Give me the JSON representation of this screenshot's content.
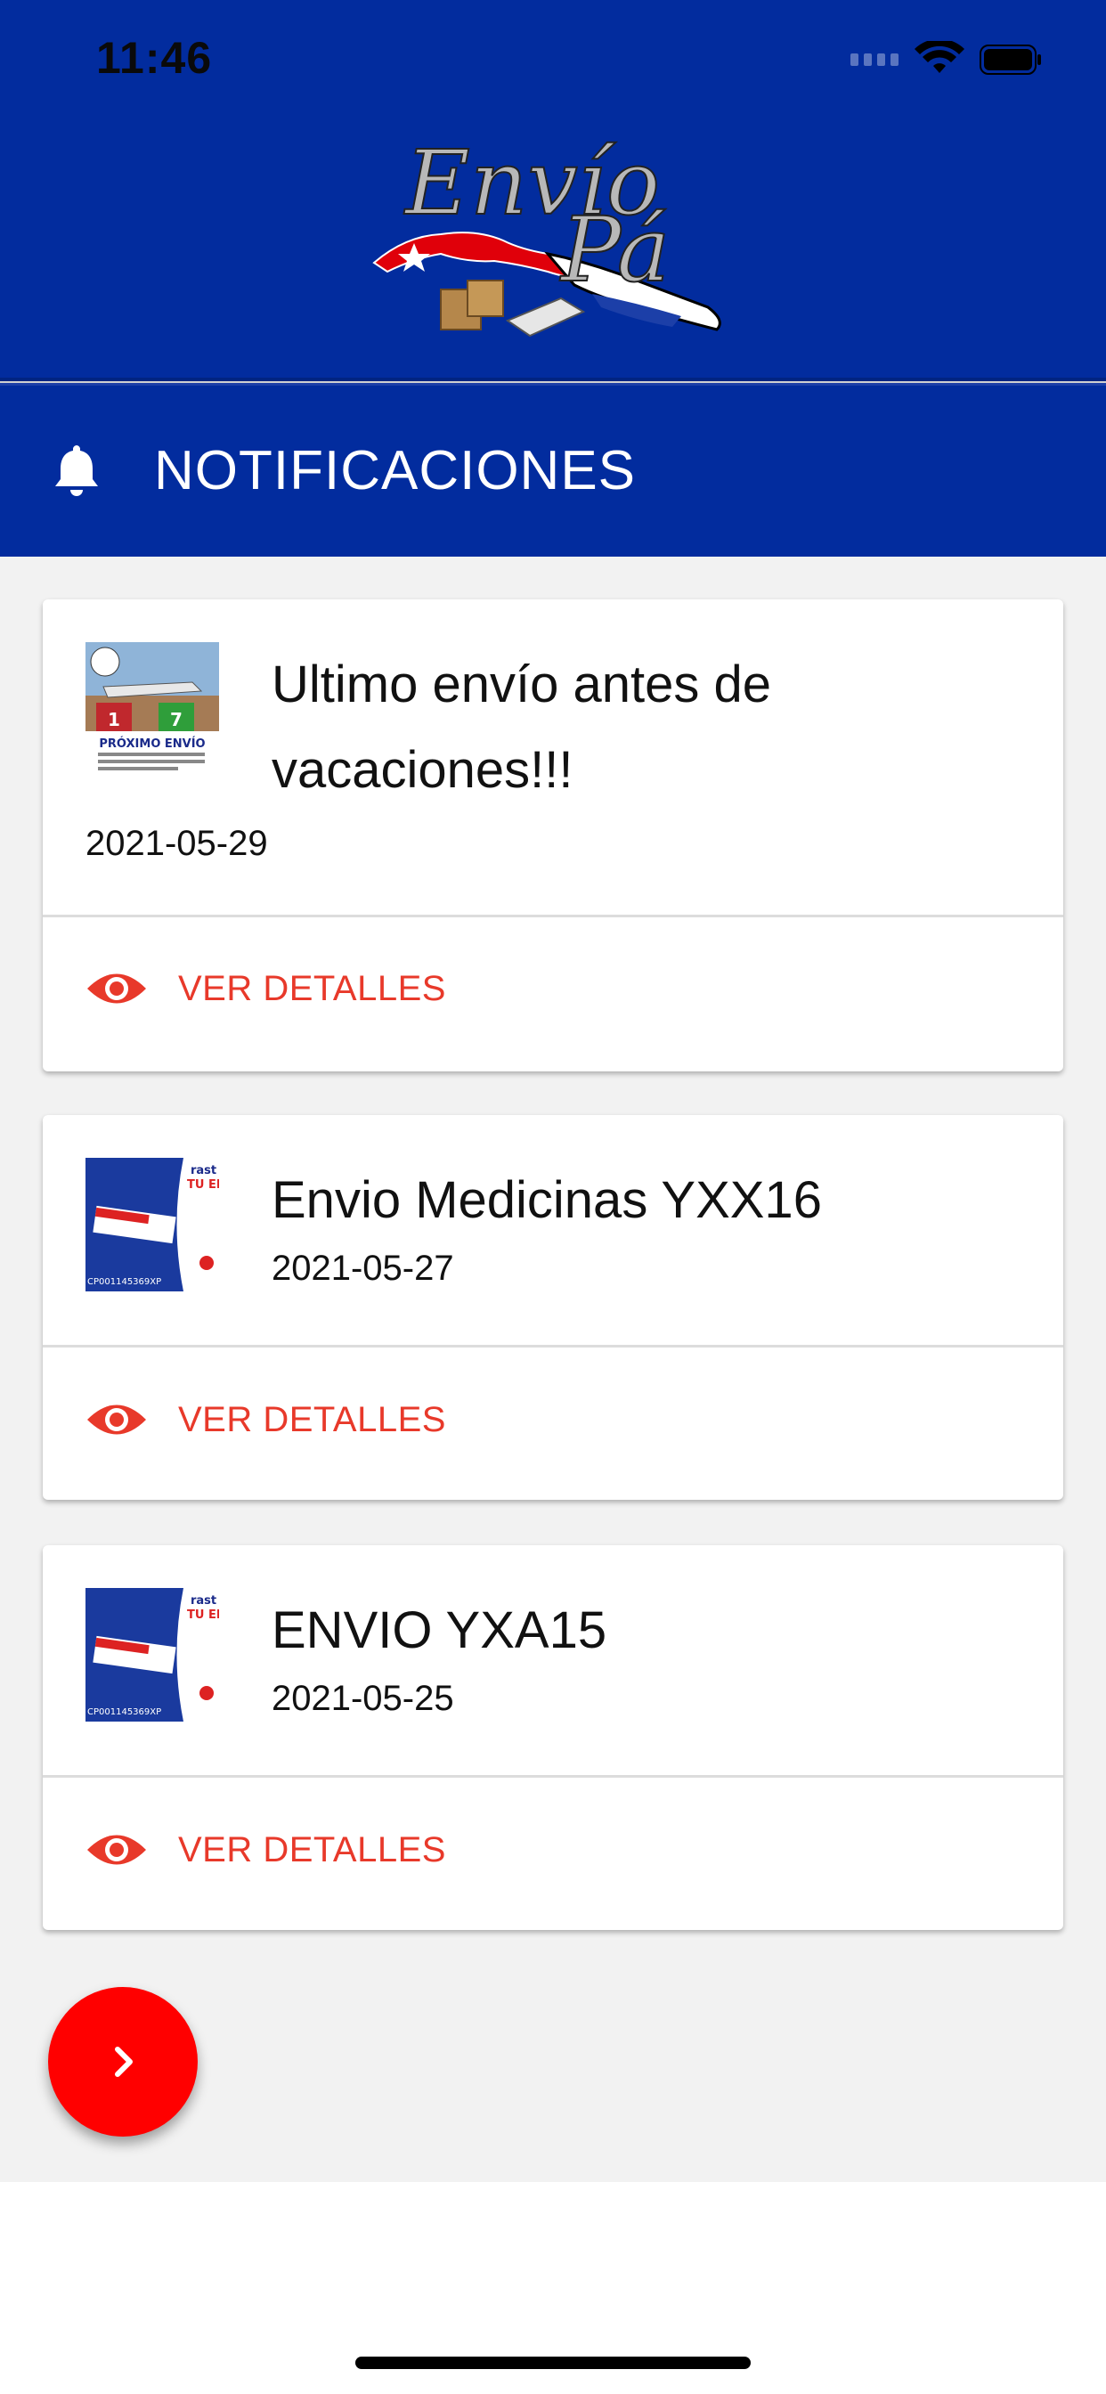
{
  "status_bar": {
    "time": "11:46"
  },
  "app": {
    "logo_text_1": "Envío",
    "logo_text_2": "Pá"
  },
  "nav": {
    "title": "NOTIFICACIONES",
    "icon": "bell-icon"
  },
  "notifications": [
    {
      "title_line1": "Ultimo envío antes de",
      "title_line2": "vacaciones!!!",
      "date": "2021-05-29",
      "thumb_caption": "PRÓXIMO ENVÍO",
      "thumb_numbers": [
        "1",
        "7"
      ],
      "action_label": "VER DETALLES"
    },
    {
      "title": "Envio Medicinas YXX16",
      "date": "2021-05-27",
      "thumb_text": [
        "rast",
        "TU EN",
        "CP00114536​9XP"
      ],
      "action_label": "VER DETALLES"
    },
    {
      "title": "ENVIO YXA15",
      "date": "2021-05-25",
      "thumb_text": [
        "rast",
        "TU EN",
        "CP00114536​9XP"
      ],
      "action_label": "VER DETALLES"
    }
  ],
  "colors": {
    "header": "#022c9e",
    "accent": "#e8392a",
    "fab": "#ff0000",
    "background": "#f2f2f2"
  },
  "fab": {
    "icon": "chevron-right-icon"
  }
}
